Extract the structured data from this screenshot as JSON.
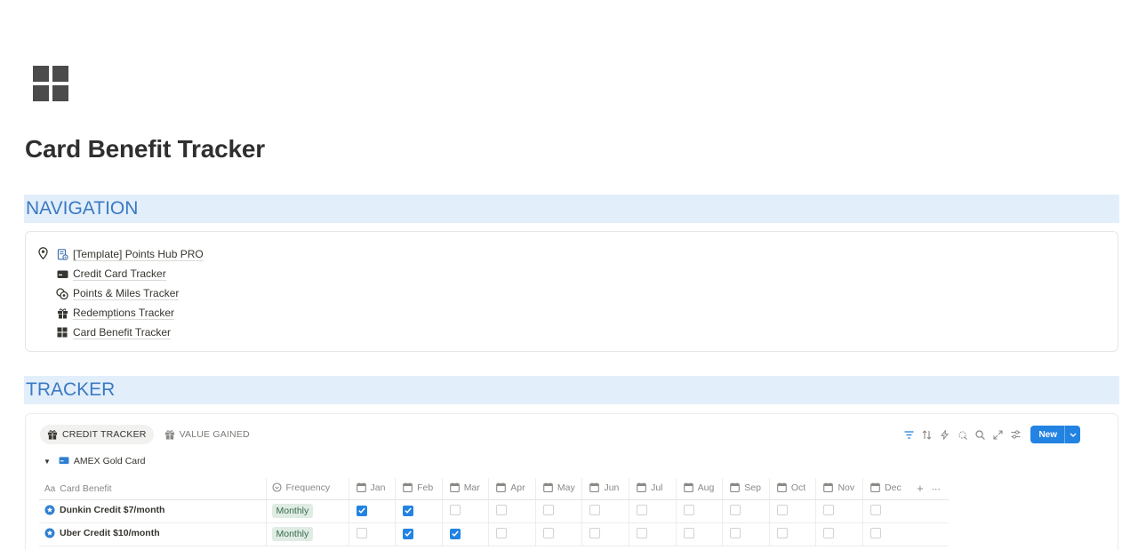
{
  "page": {
    "icon": "grid-icon",
    "title": "Card Benefit Tracker"
  },
  "navigation": {
    "heading": "NAVIGATION",
    "items": [
      {
        "label": "[Template] Points Hub PRO",
        "icon": "document-gear-icon"
      },
      {
        "label": "Credit Card Tracker",
        "icon": "credit-card-icon"
      },
      {
        "label": "Points & Miles Tracker",
        "icon": "coins-icon"
      },
      {
        "label": "Redemptions Tracker",
        "icon": "gift-icon"
      },
      {
        "label": "Card Benefit Tracker",
        "icon": "grid-icon"
      }
    ]
  },
  "tracker": {
    "heading": "TRACKER",
    "tabs": [
      {
        "label": "CREDIT TRACKER",
        "icon": "gift-icon",
        "active": true
      },
      {
        "label": "VALUE GAINED",
        "icon": "gift-icon",
        "active": false
      }
    ],
    "toolbar": {
      "icons": [
        "filter-icon",
        "sort-icon",
        "lightning-icon",
        "magic-icon",
        "search-icon",
        "expand-icon",
        "settings-icon"
      ],
      "new_label": "New"
    },
    "group": {
      "label": "AMEX Gold Card",
      "icon": "credit-card-icon"
    },
    "columns": {
      "name": "Card Benefit",
      "name_icon_text": "Aa",
      "frequency": "Frequency",
      "months": [
        "Jan",
        "Feb",
        "Mar",
        "Apr",
        "May",
        "Jun",
        "Jul",
        "Aug",
        "Sep",
        "Oct",
        "Nov",
        "Dec"
      ]
    },
    "rows": [
      {
        "name": "Dunkin Credit $7/month",
        "frequency": "Monthly",
        "checks": [
          true,
          true,
          false,
          false,
          false,
          false,
          false,
          false,
          false,
          false,
          false,
          false
        ]
      },
      {
        "name": "Uber Credit $10/month",
        "frequency": "Monthly",
        "checks": [
          false,
          true,
          true,
          false,
          false,
          false,
          false,
          false,
          false,
          false,
          false,
          false
        ]
      }
    ],
    "colors": {
      "accent": "#2383e2",
      "heading_bg": "#e3eefb",
      "heading_text": "#3a7ac2",
      "tag_bg": "#dfece4",
      "tag_text": "#386a49"
    }
  }
}
